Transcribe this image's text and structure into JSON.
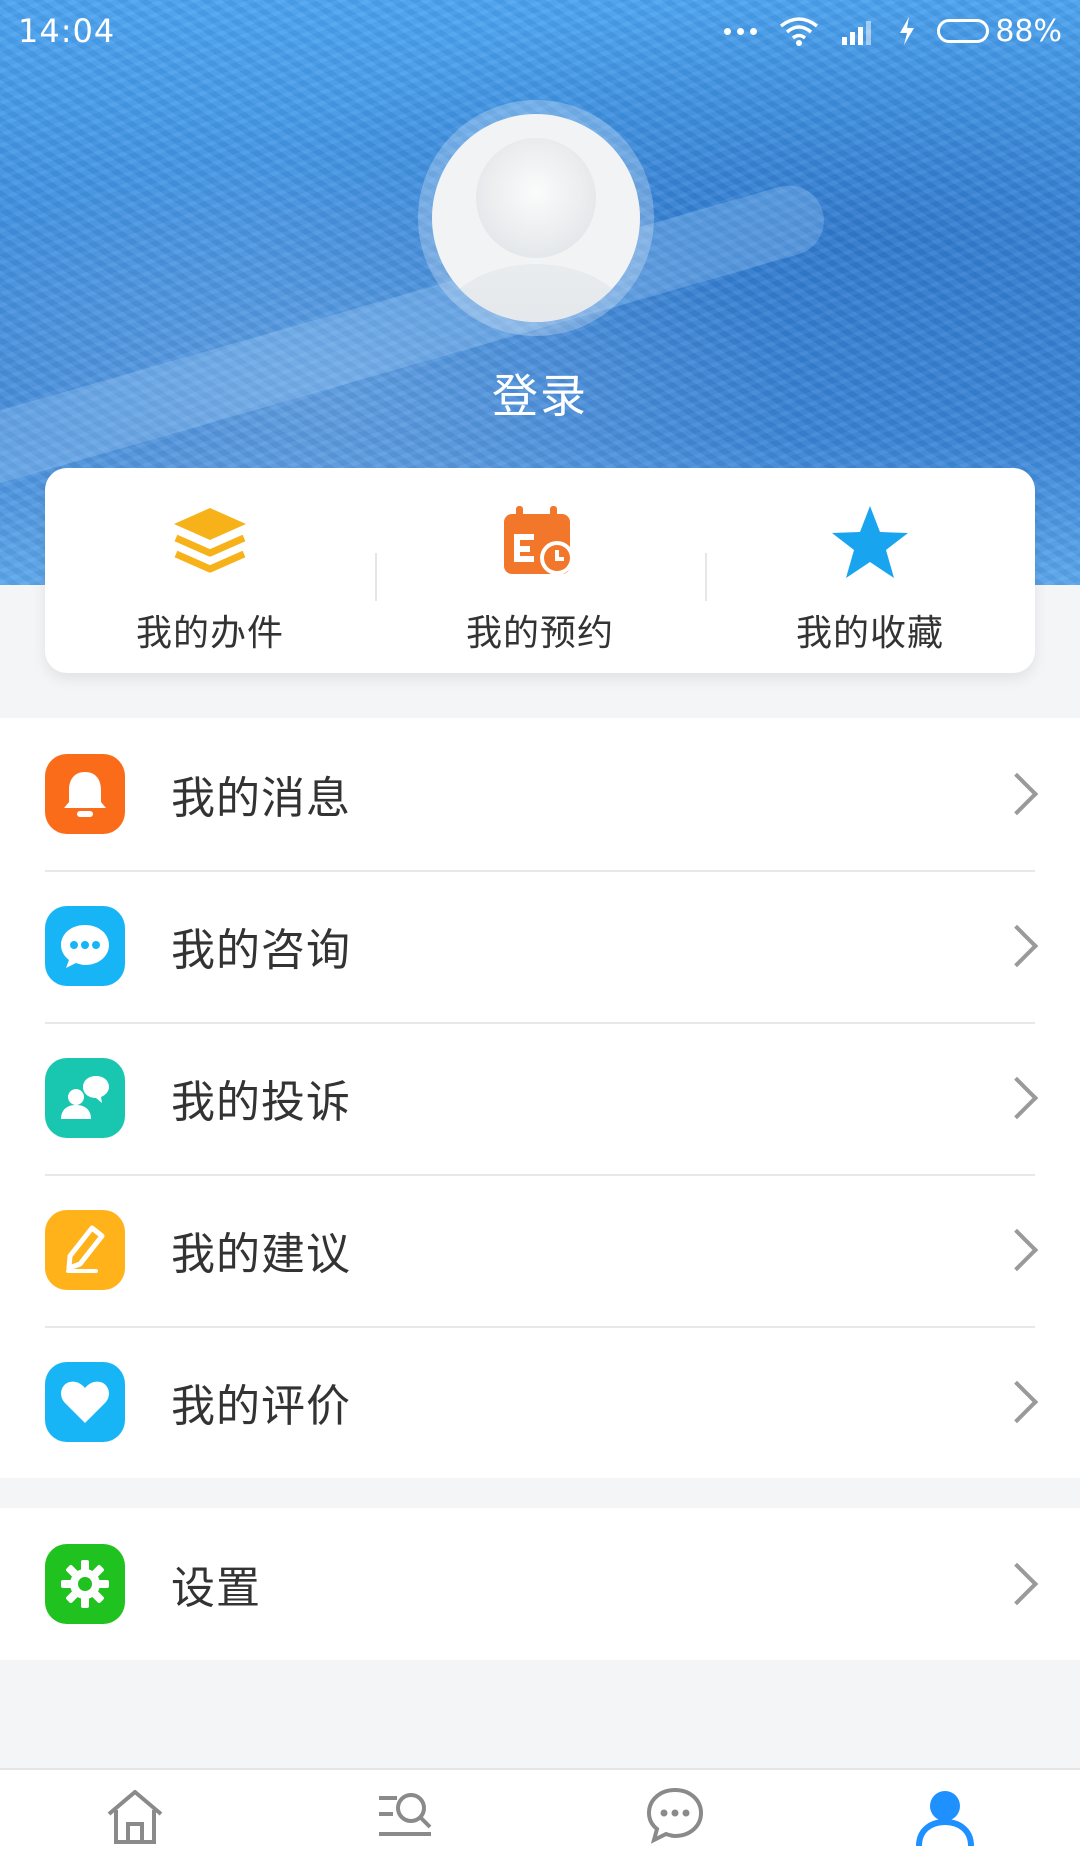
{
  "status_bar": {
    "time": "14:04",
    "battery": "88%",
    "icons": [
      "more-dots-icon",
      "wifi-icon",
      "signal-icon",
      "charging-icon",
      "battery-icon"
    ]
  },
  "profile": {
    "login_label": "登录",
    "avatar_icon": "default-avatar-icon"
  },
  "quick_actions": [
    {
      "label": "我的办件",
      "icon": "layers-icon",
      "color": "#f7b21a"
    },
    {
      "label": "我的预约",
      "icon": "calendar-clock-icon",
      "color": "#f2772a"
    },
    {
      "label": "我的收藏",
      "icon": "star-icon",
      "color": "#18a4ee"
    }
  ],
  "menu": [
    {
      "label": "我的消息",
      "icon": "bell-icon",
      "color": "#fa6c1a"
    },
    {
      "label": "我的咨询",
      "icon": "chat-bubble-icon",
      "color": "#17b5f5"
    },
    {
      "label": "我的投诉",
      "icon": "complaint-person-icon",
      "color": "#19c7b0"
    },
    {
      "label": "我的建议",
      "icon": "pencil-icon",
      "color": "#ffb21a"
    },
    {
      "label": "我的评价",
      "icon": "heart-icon",
      "color": "#17b5f5"
    }
  ],
  "settings": {
    "label": "设置",
    "icon": "gear-icon",
    "color": "#1fc21f"
  },
  "tab_bar": {
    "tabs": [
      {
        "icon": "home-icon",
        "active": false
      },
      {
        "icon": "search-list-icon",
        "active": false
      },
      {
        "icon": "chat-icon",
        "active": false
      },
      {
        "icon": "user-icon",
        "active": true
      }
    ],
    "active_color": "#1e90ff",
    "inactive_color": "#8a8a8a"
  }
}
